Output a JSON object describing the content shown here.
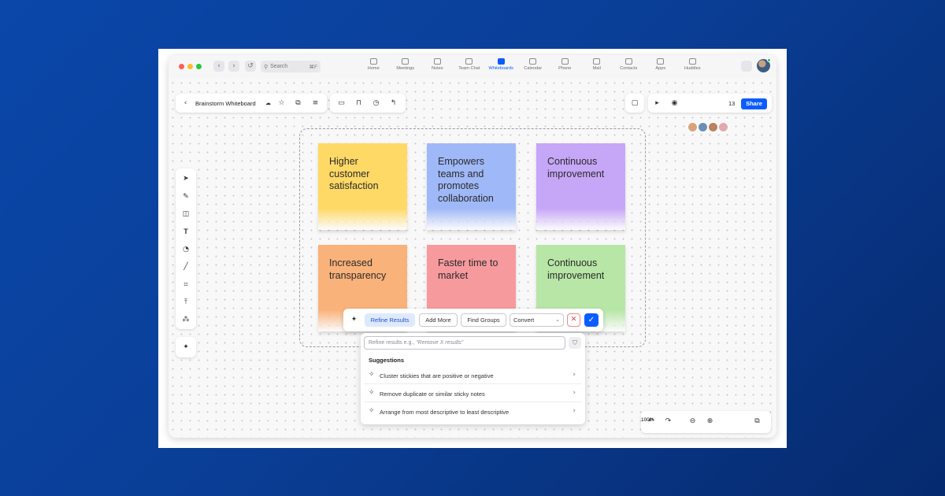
{
  "titlebar": {
    "search_placeholder": "Search",
    "search_shortcut": "⌘F",
    "nav_items": [
      {
        "label": "Home",
        "icon": "home-icon"
      },
      {
        "label": "Meetings",
        "icon": "video-camera-icon"
      },
      {
        "label": "Notes",
        "icon": "notes-icon"
      },
      {
        "label": "Team Chat",
        "icon": "chat-icon"
      },
      {
        "label": "Whiteboards",
        "icon": "whiteboard-icon",
        "active": true
      },
      {
        "label": "Calendar",
        "icon": "calendar-icon"
      },
      {
        "label": "Phone",
        "icon": "phone-icon"
      },
      {
        "label": "Mail",
        "icon": "mail-icon"
      },
      {
        "label": "Contacts",
        "icon": "contacts-icon"
      },
      {
        "label": "Apps",
        "icon": "apps-icon"
      },
      {
        "label": "Huddles",
        "icon": "huddles-icon"
      }
    ]
  },
  "board": {
    "name": "Brainstorm Whiteboard",
    "collaborator_count": "13",
    "share_label": "Share",
    "zoom_level": "100%"
  },
  "stickies": [
    {
      "text": "Higher customer satisfaction",
      "color": "#ffd966"
    },
    {
      "text": "Empowers teams and promotes collaboration",
      "color": "#9fb8f7"
    },
    {
      "text": "Continuous improvement",
      "color": "#c6a6f7"
    },
    {
      "text": "Increased transparency",
      "color": "#f9b27a"
    },
    {
      "text": "Faster time to market",
      "color": "#f79a9e"
    },
    {
      "text": "Continuous improvement",
      "color": "#b7e6a6"
    }
  ],
  "ai_bar": {
    "refine_label": "Refine Results",
    "add_more_label": "Add More",
    "find_groups_label": "Find Groups",
    "convert_label": "Convert"
  },
  "suggestions": {
    "input_prefix": "Refine results e.g., ",
    "input_example": "“Remove X results”",
    "title": "Suggestions",
    "items": [
      "Cluster stickies that are positive or negative",
      "Remove duplicate or similar sticky notes",
      "Arrange from most descriptive to least descriptive"
    ]
  },
  "colors": {
    "accent": "#0b5cff",
    "background": "#0a47a9"
  }
}
